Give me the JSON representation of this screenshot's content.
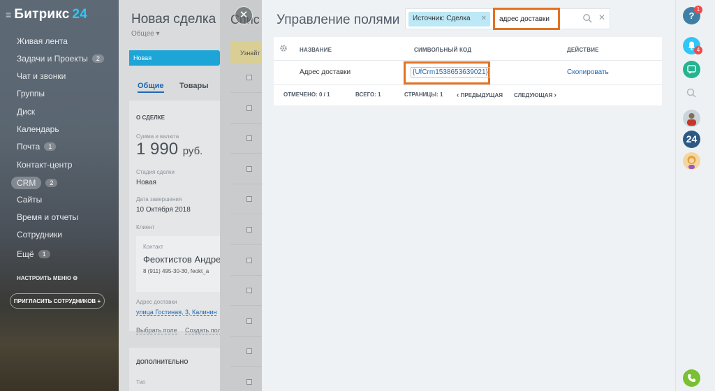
{
  "sidebar": {
    "logo_name": "Битрикс",
    "logo_num": "24",
    "items": [
      {
        "label": "Живая лента",
        "count": ""
      },
      {
        "label": "Задачи и Проекты",
        "count": "2"
      },
      {
        "label": "Чат и звонки",
        "count": ""
      },
      {
        "label": "Группы",
        "count": ""
      },
      {
        "label": "Диск",
        "count": ""
      },
      {
        "label": "Календарь",
        "count": ""
      },
      {
        "label": "Почта",
        "count": "1"
      },
      {
        "label": "Контакт-центр",
        "count": ""
      },
      {
        "label": "CRM",
        "count": "2"
      },
      {
        "label": "Сайты",
        "count": ""
      },
      {
        "label": "Время и отчеты",
        "count": ""
      },
      {
        "label": "Сотрудники",
        "count": ""
      },
      {
        "label": "Ещё",
        "count": "1"
      }
    ],
    "configure_menu": "НАСТРОИТЬ МЕНЮ",
    "invite": "ПРИГЛАСИТЬ СОТРУДНИКОВ"
  },
  "deal": {
    "title": "Новая сделка",
    "category": "Общее",
    "stage": "Новая",
    "tab_general": "Общие",
    "tab_goods": "Товары",
    "section_about": "О СДЕЛКЕ",
    "amount_label": "Сумма и валюта",
    "amount": "1 990",
    "currency": "руб.",
    "stage_label": "Стадия сделки",
    "stage_value": "Новая",
    "close_label": "Дата завершения",
    "close_value": "10 Октября 2018",
    "client_label": "Клиент",
    "contact_label": "Контакт",
    "contact_name": "Феоктистов Андрей",
    "contact_phone": "8 (911) 495-30-30, feokt_a",
    "address_label": "Адрес доставки",
    "address_value": "улица Гостиная, 3, Калинин",
    "choose_field": "Выбрать поле",
    "create_field": "Создать пол",
    "section_extra": "ДОПОЛНИТЕЛЬНО",
    "type_label": "Тип"
  },
  "strip": {
    "header": "Спис",
    "learn": "Узнайт"
  },
  "field_manager": {
    "title": "Управление полями",
    "chip": "Источник: Сделка",
    "search_value": "адрес доставки",
    "columns": {
      "name": "НАЗВАНИЕ",
      "code": "СИМВОЛЬНЫЙ КОД",
      "action": "ДЕЙСТВИЕ"
    },
    "rows": [
      {
        "name": "Адрес доставки",
        "code": "{UfCrm1538653639021}",
        "action": "Скопировать"
      }
    ],
    "footer": {
      "selected": "ОТМЕЧЕНО: 0 / 1",
      "total": "ВСЕГО: 1",
      "pages": "СТРАНИЦЫ:  1",
      "prev": "ПРЕДЫДУЩАЯ",
      "next": "СЛЕДУЮЩАЯ"
    }
  },
  "right_panel": {
    "help": "?",
    "help_badge": "1",
    "bell_badge": "4",
    "b24": "24"
  },
  "colors": {
    "accent": "#2067b0",
    "highlight": "#e37222",
    "chip": "#bde8f6",
    "stage": "#1ca5d6"
  }
}
